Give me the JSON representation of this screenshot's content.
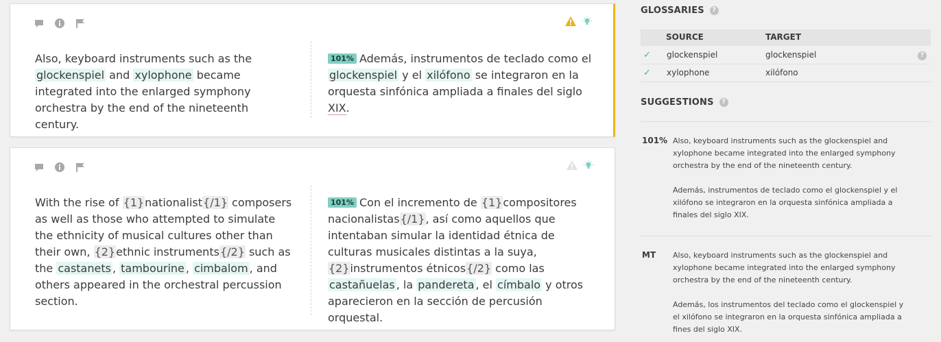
{
  "segments": [
    {
      "source": [
        {
          "t": "text",
          "v": "Also, keyboard instruments such as the "
        },
        {
          "t": "term",
          "v": "glockenspiel"
        },
        {
          "t": "text",
          "v": " and "
        },
        {
          "t": "term",
          "v": "xylophone"
        },
        {
          "t": "text",
          "v": " became integrated into the enlarged symphony orchestra by the end of the nineteenth century."
        }
      ],
      "match": "101%",
      "target": [
        {
          "t": "text",
          "v": "Además, instrumentos de teclado como el "
        },
        {
          "t": "term",
          "v": "glockenspiel"
        },
        {
          "t": "text",
          "v": " y el "
        },
        {
          "t": "term",
          "v": "xilófono"
        },
        {
          "t": "text",
          "v": " se integraron en la orquesta sinfónica ampliada a finales del siglo "
        },
        {
          "t": "spell",
          "v": "XIX"
        },
        {
          "t": "text",
          "v": "."
        }
      ]
    },
    {
      "source": [
        {
          "t": "text",
          "v": "With the rise of "
        },
        {
          "t": "tag",
          "v": "{1}"
        },
        {
          "t": "text",
          "v": "nationalist"
        },
        {
          "t": "tag",
          "v": "{/1}"
        },
        {
          "t": "text",
          "v": " composers as well as those who attempted to simulate the ethnicity of musical cultures other than their own, "
        },
        {
          "t": "tag",
          "v": "{2}"
        },
        {
          "t": "text",
          "v": "ethnic instruments"
        },
        {
          "t": "tag",
          "v": "{/2}"
        },
        {
          "t": "text",
          "v": " such as the "
        },
        {
          "t": "term",
          "v": "castanets"
        },
        {
          "t": "text",
          "v": ", "
        },
        {
          "t": "term",
          "v": "tambourine"
        },
        {
          "t": "text",
          "v": ", "
        },
        {
          "t": "term",
          "v": "cimbalom"
        },
        {
          "t": "text",
          "v": ", and others appeared in the orchestral percussion section."
        }
      ],
      "match": "101%",
      "target": [
        {
          "t": "text",
          "v": "Con el incremento de "
        },
        {
          "t": "tag",
          "v": "{1}"
        },
        {
          "t": "text",
          "v": "compositores nacionalistas"
        },
        {
          "t": "tag",
          "v": "{/1}"
        },
        {
          "t": "text",
          "v": ", así como aquellos que intentaban simular la identidad étnica de culturas musicales distintas a la suya, "
        },
        {
          "t": "tag",
          "v": "{2}"
        },
        {
          "t": "text",
          "v": "instrumentos étnicos"
        },
        {
          "t": "tag",
          "v": "{/2}"
        },
        {
          "t": "text",
          "v": " como las "
        },
        {
          "t": "term",
          "v": "castañuelas"
        },
        {
          "t": "text",
          "v": ", la "
        },
        {
          "t": "term",
          "v": "pandereta"
        },
        {
          "t": "text",
          "v": ", el "
        },
        {
          "t": "term",
          "v": "címbalo"
        },
        {
          "t": "text",
          "v": " y otros aparecieron en la sección de percusión orquestal."
        }
      ]
    }
  ],
  "glossaries": {
    "title": "GLOSSARIES",
    "help": "?",
    "col_source": "SOURCE",
    "col_target": "TARGET",
    "rows": [
      {
        "check": "✓",
        "source": "glockenspiel",
        "target": "glockenspiel",
        "help": "?"
      },
      {
        "check": "✓",
        "source": "xylophone",
        "target": "xilófono"
      }
    ]
  },
  "suggestions": {
    "title": "SUGGESTIONS",
    "help": "?",
    "items": [
      {
        "label": "101%",
        "source": "Also, keyboard instruments such as the glockenspiel and xylophone became integrated into the enlarged symphony orchestra by the end of the nineteenth century.",
        "target": "Además, instrumentos de teclado como el glockenspiel y el xilófono se integraron en la orquesta sinfónica ampliada a finales del siglo XIX."
      },
      {
        "label": "MT",
        "source": "Also, keyboard instruments such as the glockenspiel and xylophone became integrated into the enlarged symphony orchestra by the end of the nineteenth century.",
        "target": "Además, los instrumentos del teclado como el glockenspiel y el xilófono se integraron en la orquesta sinfónica ampliada a fines del siglo XIX."
      }
    ]
  },
  "colors": {
    "accent_yellow": "#e8b817",
    "match_badge": "#7fd0c2",
    "term_highlight": "#e3f6f3",
    "warning": "#e6b21a",
    "bulb": "#7fd0c2"
  }
}
